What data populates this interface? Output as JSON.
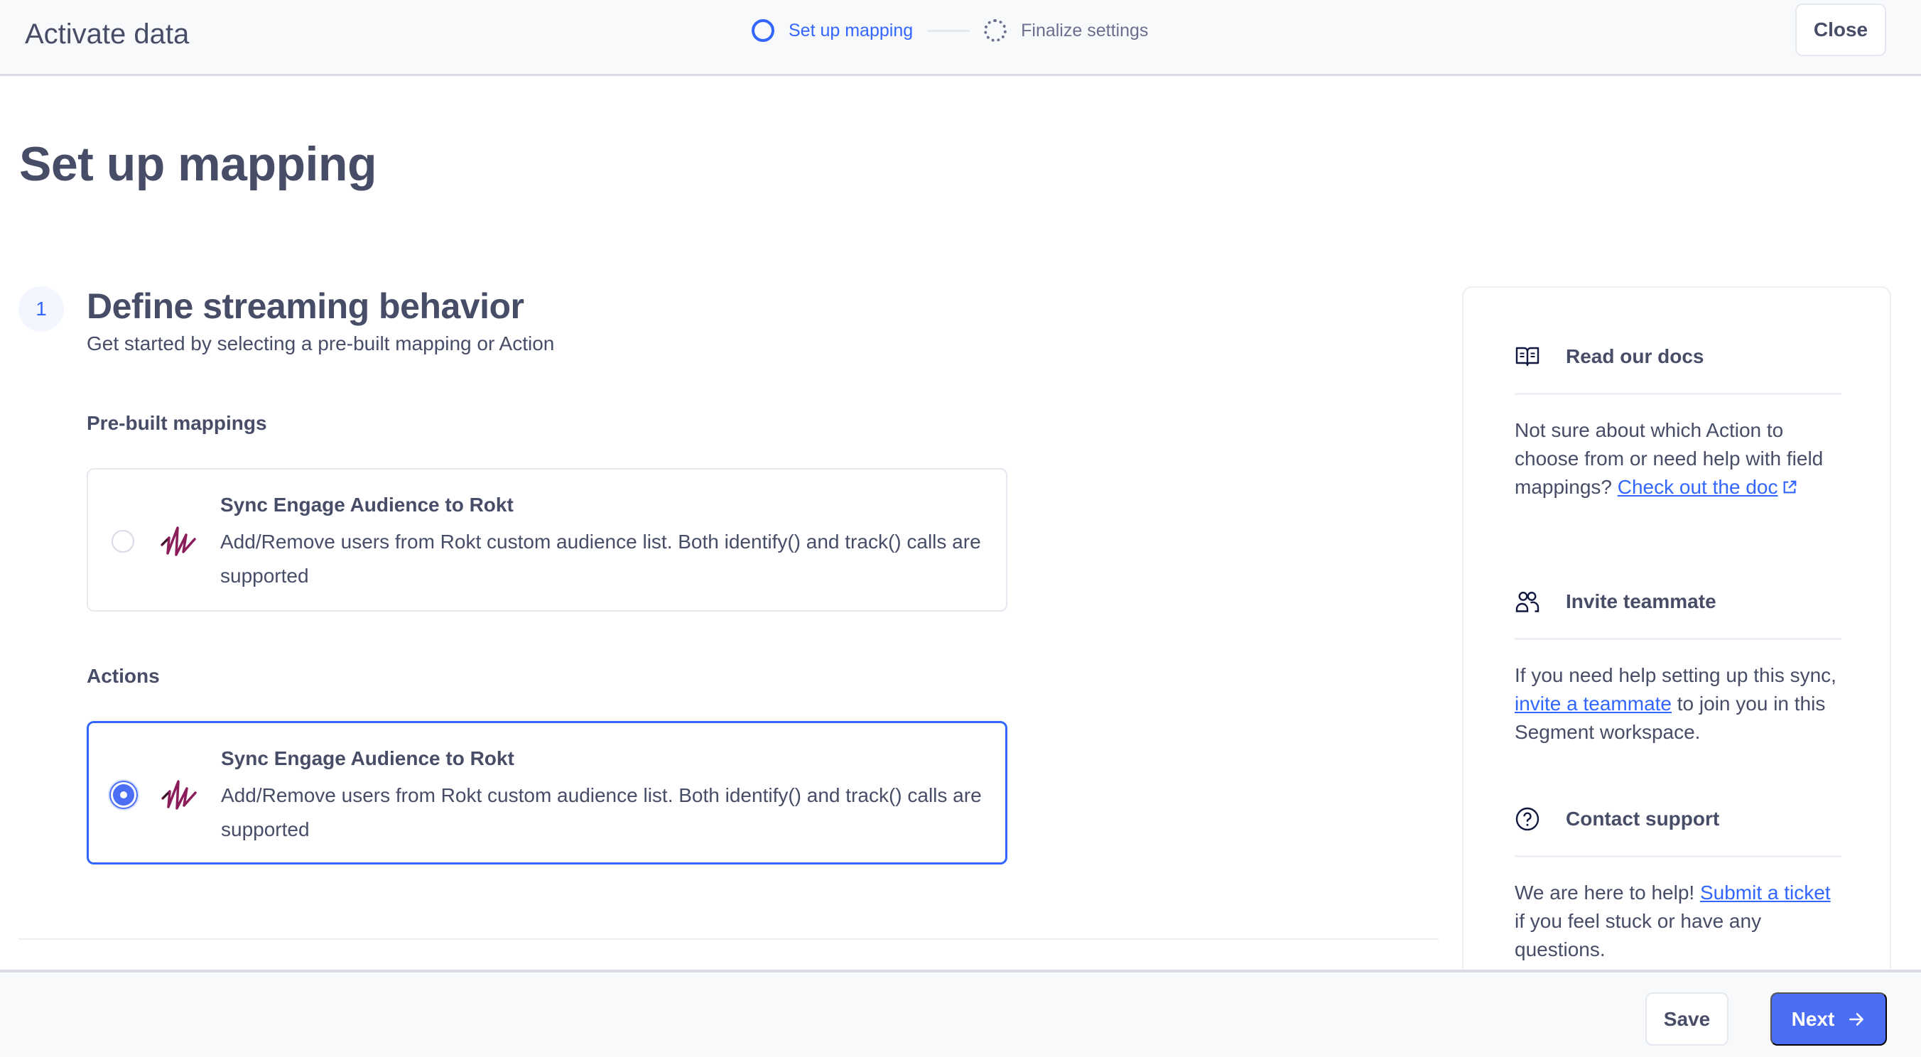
{
  "header": {
    "title": "Activate data",
    "steps": [
      {
        "label": "Set up mapping",
        "state": "active"
      },
      {
        "label": "Finalize settings",
        "state": "pending"
      }
    ],
    "close_label": "Close"
  },
  "page": {
    "title": "Set up mapping"
  },
  "section": {
    "number": "1",
    "heading": "Define streaming behavior",
    "subtitle": "Get started by selecting a pre-built mapping or Action"
  },
  "prebuilt": {
    "label": "Pre-built mappings",
    "options": [
      {
        "title": "Sync Engage Audience to Rokt",
        "description": "Add/Remove users from Rokt custom audience list. Both identify() and track() calls are supported",
        "selected": false,
        "logo": "rokt-logo"
      }
    ]
  },
  "actions": {
    "label": "Actions",
    "options": [
      {
        "title": "Sync Engage Audience to Rokt",
        "description": "Add/Remove users from Rokt custom audience list. Both identify() and track() calls are supported",
        "selected": true,
        "logo": "rokt-logo"
      }
    ]
  },
  "help": {
    "docs": {
      "icon": "book-icon",
      "title": "Read our docs",
      "text_before": "Not sure about which Action to choose from or need help with field mappings? ",
      "link": "Check out the doc",
      "link_icon": "external-link-icon"
    },
    "invite": {
      "icon": "users-icon",
      "title": "Invite teammate",
      "text_before": "If you need help setting up this sync, ",
      "link": "invite a teammate",
      "text_after": " to join you in this Segment workspace."
    },
    "support": {
      "icon": "help-circle-icon",
      "title": "Contact support",
      "text_before": "We are here to help! ",
      "link": "Submit a ticket",
      "text_after": " if you feel stuck or have any questions."
    }
  },
  "footer": {
    "save_label": "Save",
    "next_label": "Next",
    "next_icon": "arrow-right-icon"
  },
  "colors": {
    "accent": "#3366ff",
    "primary_button": "#4c6ef5",
    "text": "#474d66",
    "muted_text": "#696f8c",
    "border": "#e6e8f0",
    "header_bg": "#f8f9fb",
    "rokt_logo": "#8b1e5a"
  }
}
